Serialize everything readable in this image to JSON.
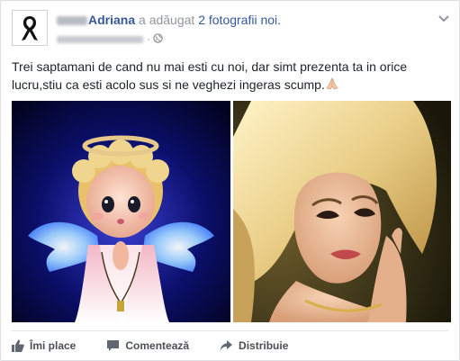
{
  "post": {
    "author_name": "Adriana",
    "action_text": "a adăugat",
    "action_link": "2 fotografii noi.",
    "text": "Trei saptamani de cand nu mai esti cu noi, dar simt prezenta ta in orice lucru,stiu ca esti acolo sus si ne veghezi ingeras scump.",
    "photos": [
      {
        "icon": "angel-doll-image"
      },
      {
        "icon": "woman-portrait-image"
      }
    ]
  },
  "actions": {
    "like": "Îmi place",
    "comment": "Comentează",
    "share": "Distribuie"
  },
  "colors": {
    "link": "#365899",
    "meta": "#90949c",
    "text": "#1d2129",
    "action": "#4b4f56"
  }
}
